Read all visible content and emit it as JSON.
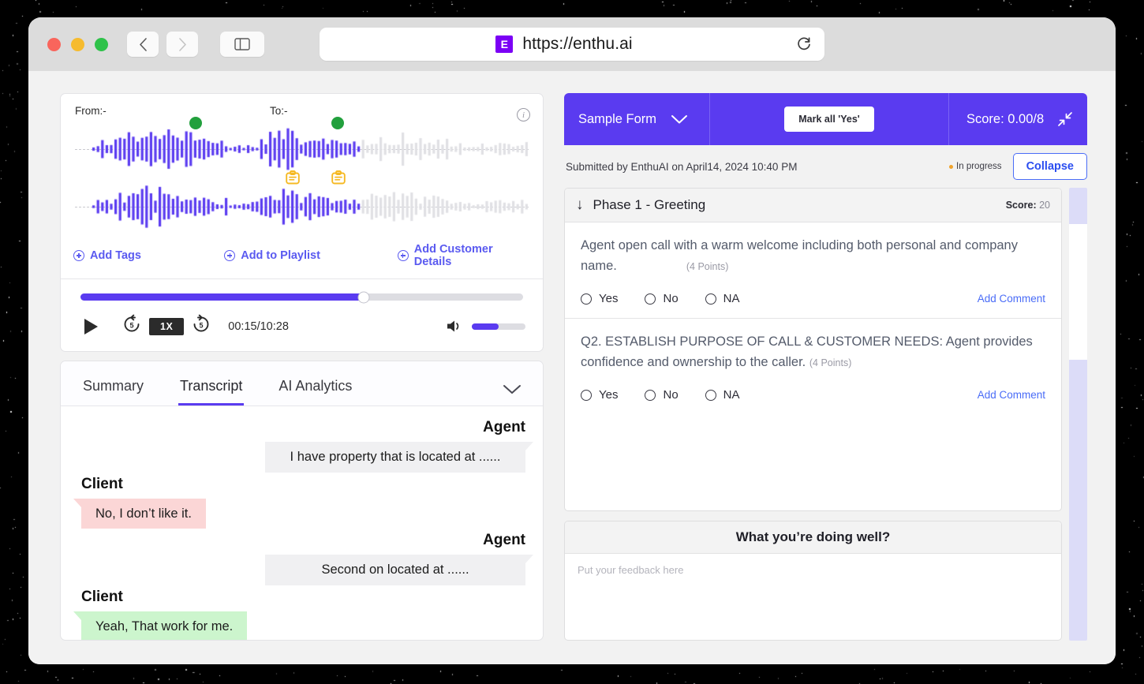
{
  "browser": {
    "url": "https://enthu.ai",
    "favicon_letter": "E",
    "back_icon": "chevron-left-icon",
    "forward_icon": "chevron-right-icon",
    "sidebar_icon": "sidebar-toggle-icon",
    "reload_icon": "↻"
  },
  "player": {
    "from_label": "From:-",
    "to_label": "To:-",
    "info_icon": "i",
    "links": [
      {
        "label": "Add Tags"
      },
      {
        "label": "Add to Playlist"
      },
      {
        "label": "Add Customer Details"
      }
    ],
    "seek_percent": 64,
    "speed": "1X",
    "skip_back": "5",
    "skip_forward": "5",
    "timecode": "00:15/10:28",
    "volume_percent": 50,
    "waveform_played_percent": 62,
    "markers": [
      {
        "type": "green-dot",
        "position": 25
      },
      {
        "type": "green-dot",
        "position": 56
      },
      {
        "type": "note",
        "position": 46
      },
      {
        "type": "note",
        "position": 56
      }
    ]
  },
  "tabs": {
    "items": [
      {
        "label": "Summary",
        "active": false
      },
      {
        "label": "Transcript",
        "active": true
      },
      {
        "label": "AI Analytics",
        "active": false
      }
    ],
    "chevron": "⌄"
  },
  "transcript": [
    {
      "speaker": "Agent",
      "side": "agent",
      "text": "I have property that is located at ......",
      "tone": "neutral"
    },
    {
      "speaker": "Client",
      "side": "client",
      "text": "No, I don’t like it.",
      "tone": "negative"
    },
    {
      "speaker": "Agent",
      "side": "agent",
      "text": "Second on located at ......",
      "tone": "neutral"
    },
    {
      "speaker": "Client",
      "side": "client",
      "text": "Yeah, That work for me.",
      "tone": "positive"
    }
  ],
  "form": {
    "name": "Sample Form",
    "name_chevron": "⌄",
    "mark_all_yes": "Mark all 'Yes'",
    "score": "Score: 0.00/8",
    "minimize_icon": "collapse-diagonal-icon",
    "submitted": "Submitted by EnthuAI on April14, 2024 10:40 PM",
    "status": "In progress",
    "collapse": "Collapse",
    "phase": {
      "arrow": "↓",
      "title": "Phase 1 - Greeting",
      "score_label": "Score:",
      "score_value": "20"
    },
    "questions": [
      {
        "text": "Agent open call with a warm welcome including both personal and company name.",
        "points": "(4 Points)",
        "options": [
          "Yes",
          "No",
          "NA"
        ],
        "comment_label": "Add Comment"
      },
      {
        "text": "Q2. ESTABLISH PURPOSE OF CALL & CUSTOMER NEEDS: Agent provides confidence and ownership to the caller.",
        "points": "(4 Points)",
        "options": [
          "Yes",
          "No",
          "NA"
        ],
        "comment_label": "Add Comment"
      }
    ],
    "feedback": {
      "title": "What you’re doing well?",
      "placeholder": "Put your feedback here",
      "value": ""
    }
  },
  "colors": {
    "brand_purple": "#5a3bf0",
    "link_blue": "#4a6cf7",
    "marker_green": "#22a03d",
    "note_yellow": "#f5b923",
    "status_orange": "#f0a32b",
    "negative_bubble": "#fbd6d6",
    "positive_bubble": "#ccf5cd"
  }
}
